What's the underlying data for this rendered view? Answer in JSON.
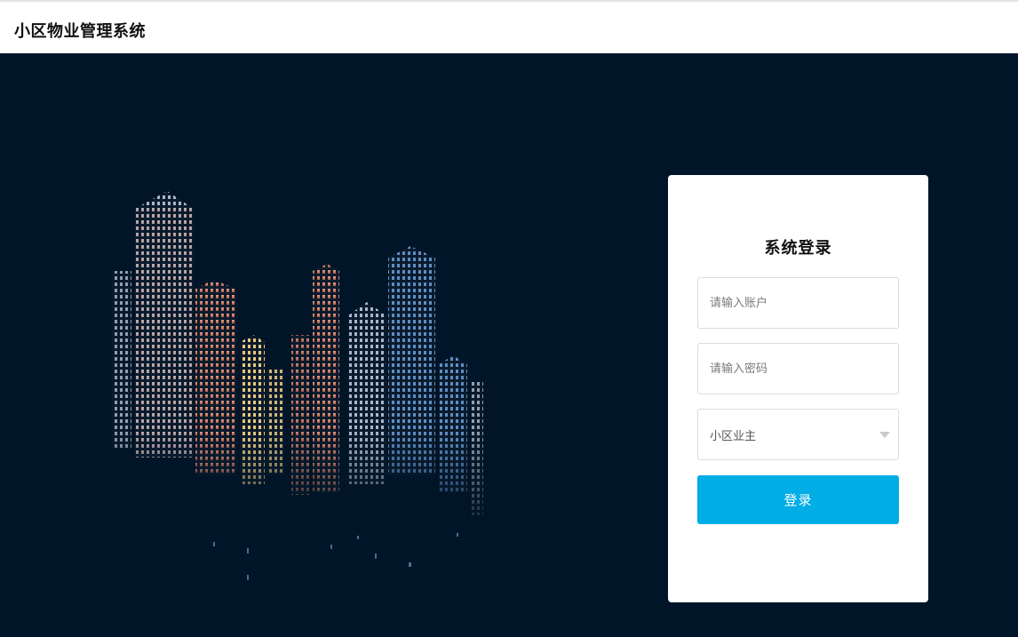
{
  "header": {
    "title": "小区物业管理系统"
  },
  "login": {
    "title": "系统登录",
    "account_placeholder": "请输入账户",
    "password_placeholder": "请输入密码",
    "role_selected": "小区业主",
    "submit_label": "登录"
  },
  "colors": {
    "background": "#011528",
    "button": "#01ade5",
    "window_lights_warm": "#e7a07c",
    "window_lights_cool": "#6fa6d8",
    "window_lights_yellow": "#f1d88a"
  },
  "illustration": {
    "icon": "city-skyline-night-icon"
  }
}
